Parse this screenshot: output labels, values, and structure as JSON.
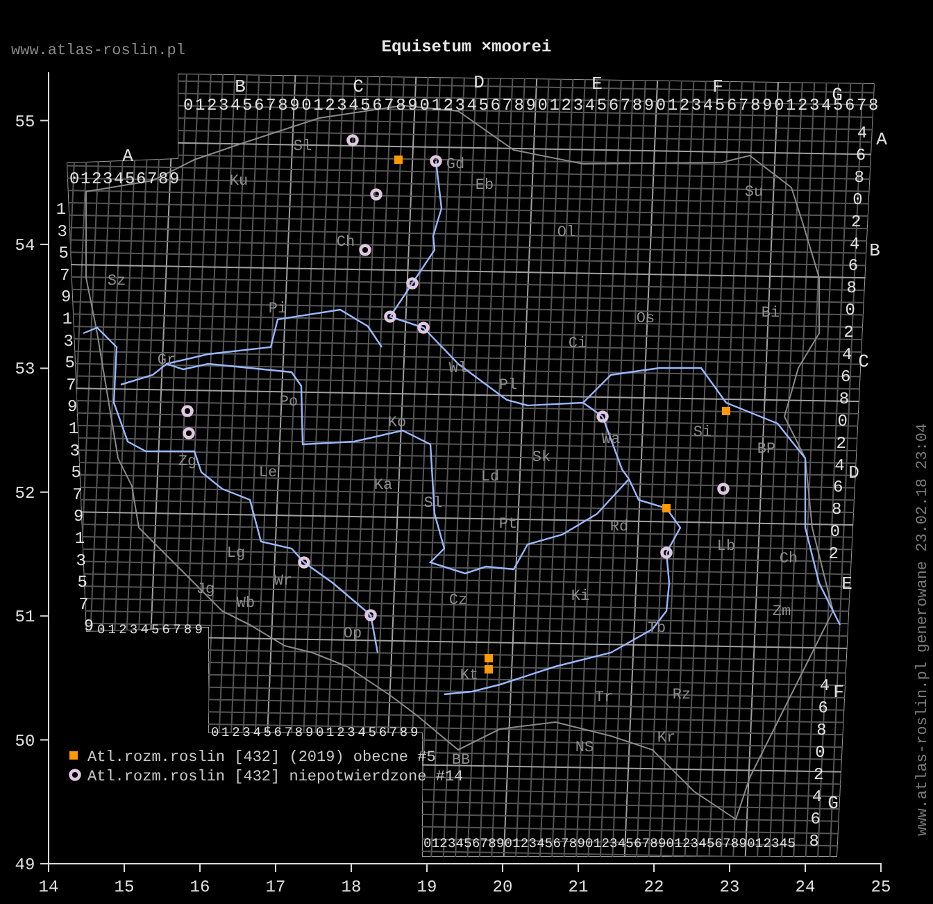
{
  "site_url": "www.atlas-roslin.pl",
  "title": "Equisetum ×moorei",
  "generated_note": "www.atlas-roslin.pl generowane 23.02.18 23:04",
  "map": {
    "column_letters": [
      "A",
      "B",
      "C",
      "D",
      "E",
      "F",
      "G"
    ],
    "top_digits": [
      "0123456789",
      "01234567890123456789012345678901234567890123456789012345678"
    ],
    "bottom_digits": [
      "0123456789",
      "01234567890123456789",
      "0123456789012345678901234567890123456789012345"
    ],
    "left_digits": [
      "1",
      "3",
      "5",
      "7",
      "9",
      "1",
      "3",
      "5",
      "7",
      "9",
      "1",
      "3",
      "5",
      "7",
      "9",
      "1",
      "3",
      "5",
      "7",
      "9"
    ],
    "row_letters": [
      "A",
      "B",
      "C",
      "D",
      "E",
      "F",
      "G"
    ],
    "right_digits": [
      "4",
      "6",
      "8",
      "0",
      "2",
      "4",
      "6",
      "8",
      "0",
      "2",
      "4",
      "6",
      "8",
      "0",
      "2",
      "4",
      "6",
      "8",
      "0",
      "2",
      "4",
      "6",
      "8",
      "0",
      "2",
      "4",
      "6",
      "8"
    ],
    "region_codes": [
      "Sl",
      "Gd",
      "Ku",
      "Eb",
      "Su",
      "Ch",
      "Ol",
      "Sz",
      "Pi",
      "Gr",
      "Ci",
      "Os",
      "Bi",
      "Wl",
      "Pl",
      "Po",
      "Wa",
      "Sk",
      "Si",
      "Ko",
      "Zg",
      "Le",
      "Ld",
      "BP",
      "Ka",
      "Sl",
      "Pt",
      "Rd",
      "Lb",
      "Ch",
      "Lg",
      "Wr",
      "Jg",
      "Wb",
      "Op",
      "Cz",
      "Ki",
      "Zm",
      "Tb",
      "Kt",
      "Tr",
      "Rz",
      "BB",
      "NS",
      "Kr"
    ]
  },
  "axes": {
    "x_ticks": [
      "14",
      "15",
      "16",
      "17",
      "18",
      "19",
      "20",
      "21",
      "22",
      "23",
      "24",
      "25"
    ],
    "y_ticks": [
      "55",
      "54",
      "53",
      "52",
      "51",
      "50",
      "49"
    ]
  },
  "legend": [
    {
      "kind": "square",
      "color": "#ff9900",
      "label": "Atl.rozm.roslin [432] (2019) obecne #5"
    },
    {
      "kind": "ring",
      "color": "#e0c8e0",
      "label": "Atl.rozm.roslin [432] niepotwierdzone #14"
    }
  ]
}
